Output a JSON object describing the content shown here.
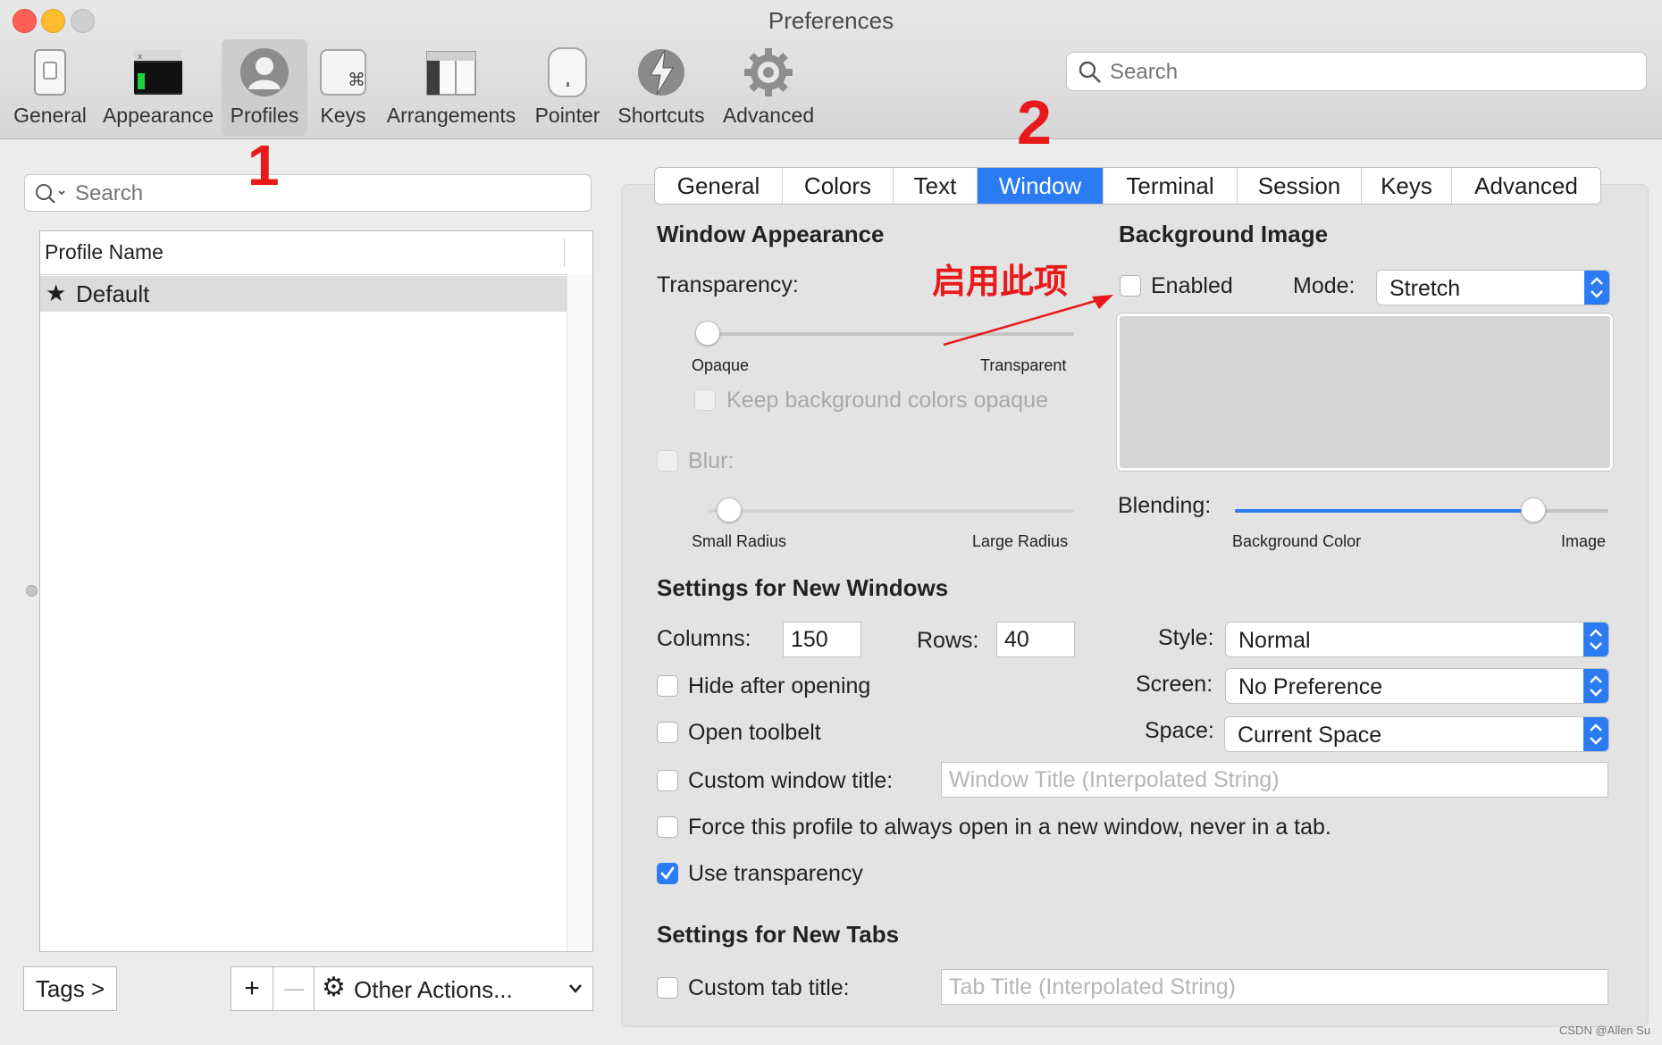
{
  "window": {
    "title": "Preferences"
  },
  "toolbar": {
    "items": [
      {
        "label": "General",
        "icon": "general-switch-icon"
      },
      {
        "label": "Appearance",
        "icon": "terminal-window-icon"
      },
      {
        "label": "Profiles",
        "icon": "user-silhouette-icon",
        "selected": true
      },
      {
        "label": "Keys",
        "icon": "command-key-icon"
      },
      {
        "label": "Arrangements",
        "icon": "window-layout-icon"
      },
      {
        "label": "Pointer",
        "icon": "mouse-icon"
      },
      {
        "label": "Shortcuts",
        "icon": "lightning-bolt-icon"
      },
      {
        "label": "Advanced",
        "icon": "gear-icon"
      }
    ],
    "search_placeholder": "Search"
  },
  "left": {
    "search_placeholder": "Search",
    "column_header": "Profile Name",
    "profiles": [
      {
        "name": "Default",
        "default": true
      }
    ],
    "tags_button": "Tags >",
    "add_button": "+",
    "remove_button": "—",
    "other_actions": "Other Actions..."
  },
  "tabs": [
    "General",
    "Colors",
    "Text",
    "Window",
    "Terminal",
    "Session",
    "Keys",
    "Advanced"
  ],
  "active_tab": "Window",
  "window_appearance": {
    "heading": "Window Appearance",
    "transparency_label": "Transparency:",
    "transparency_value": 0,
    "opaque": "Opaque",
    "transparent": "Transparent",
    "keep_bg_opaque": "Keep background colors opaque",
    "blur_label": "Blur:",
    "blur_value": 0.06,
    "small_radius": "Small Radius",
    "large_radius": "Large Radius"
  },
  "background_image": {
    "heading": "Background Image",
    "enabled_label": "Enabled",
    "mode_label": "Mode:",
    "mode_value": "Stretch",
    "blending_label": "Blending:",
    "blending_value": 0.8,
    "background_color": "Background Color",
    "image": "Image"
  },
  "new_windows": {
    "heading": "Settings for New Windows",
    "columns_label": "Columns:",
    "columns_value": "150",
    "rows_label": "Rows:",
    "rows_value": "40",
    "style_label": "Style:",
    "style_value": "Normal",
    "screen_label": "Screen:",
    "screen_value": "No Preference",
    "space_label": "Space:",
    "space_value": "Current Space",
    "hide_after_opening": "Hide after opening",
    "open_toolbelt": "Open toolbelt",
    "custom_window_title": "Custom window title:",
    "window_title_placeholder": "Window Title (Interpolated String)",
    "force_new_window": "Force this profile to always open in a new window, never in a tab.",
    "use_transparency": "Use transparency"
  },
  "new_tabs": {
    "heading": "Settings for New Tabs",
    "custom_tab_title": "Custom tab title:",
    "tab_title_placeholder": "Tab Title (Interpolated String)"
  },
  "annotations": {
    "step1": "1",
    "step2": "2",
    "enable_note": "启用此项",
    "watermark": "CSDN @Allen Su"
  },
  "colors": {
    "accent": "#2b7bf2",
    "annotation": "#e8191a"
  }
}
